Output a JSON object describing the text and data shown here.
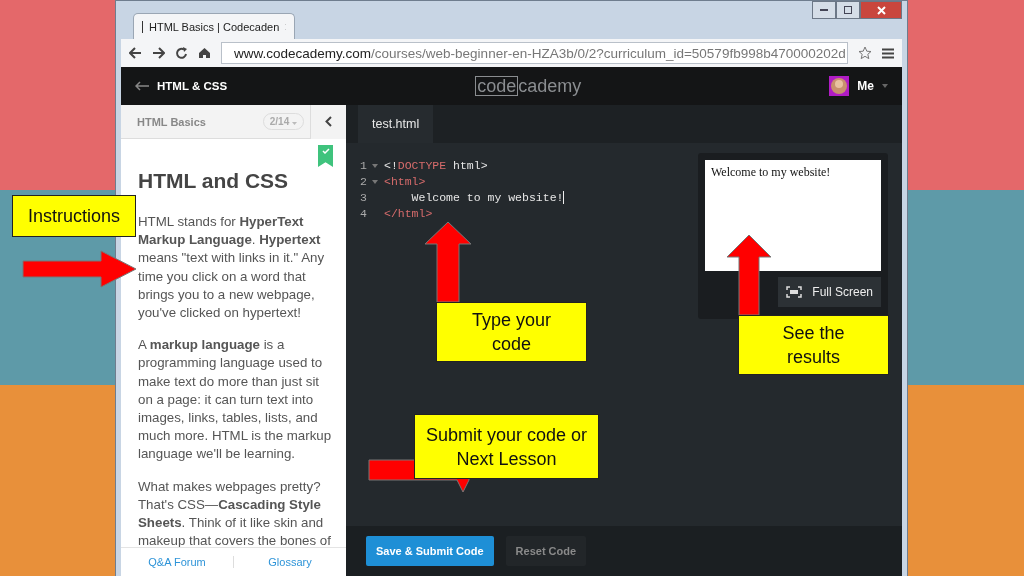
{
  "browser": {
    "tab_title": "HTML Basics | Codecaden",
    "url_domain": "www.codecademy.com",
    "url_path": "/courses/web-beginner-en-HZA3b/0/2?curriculum_id=50579fb998b470000202d"
  },
  "header": {
    "back_label": "HTML & CSS",
    "logo_parts": [
      "code",
      "cademy"
    ],
    "user": "Me"
  },
  "lesson": {
    "course": "HTML Basics",
    "progress": "2/14",
    "completed": true,
    "title": "HTML and CSS",
    "paragraphs": [
      "HTML stands for **HyperText Markup Language**. **Hypertext** means \"text with links in it.\" Any time you click on a word that brings you to a new webpage, you've clicked on hypertext!",
      "A **markup language** is a programming language used to make text do more than just sit on a page: it can turn text into images, links, tables, lists, and much more. HTML is the markup language we'll be learning.",
      "What makes webpages pretty? That's CSS—**Cascading Style Sheets**. Think of it like skin and makeup that covers the bones of"
    ],
    "footer_links": [
      "Q&A Forum",
      "Glossary"
    ]
  },
  "editor": {
    "tab": "test.html",
    "lines": [
      {
        "number": "1",
        "foldable": true,
        "segments": [
          {
            "kind": "plain",
            "text": "<!"
          },
          {
            "kind": "tag",
            "text": "DOCTYPE"
          },
          {
            "kind": "plain",
            "text": " html>"
          }
        ]
      },
      {
        "number": "2",
        "foldable": true,
        "segments": [
          {
            "kind": "tag",
            "text": "<html>"
          }
        ]
      },
      {
        "number": "3",
        "foldable": false,
        "segments": [
          {
            "kind": "plain",
            "text": "    Welcome to my website!"
          }
        ]
      },
      {
        "number": "4",
        "foldable": false,
        "segments": [
          {
            "kind": "tag",
            "text": "</html>"
          }
        ]
      }
    ]
  },
  "preview": {
    "text": "Welcome to my website!",
    "button": "Full Screen"
  },
  "actions": [
    {
      "label": "Save & Submit Code",
      "kind": "primary"
    },
    {
      "label": "Reset Code",
      "kind": "secondary"
    }
  ],
  "callouts": [
    {
      "text": "Instructions"
    },
    {
      "text": "Type your code"
    },
    {
      "text": "See the results"
    },
    {
      "text": "Submit your code or Next Lesson"
    }
  ]
}
